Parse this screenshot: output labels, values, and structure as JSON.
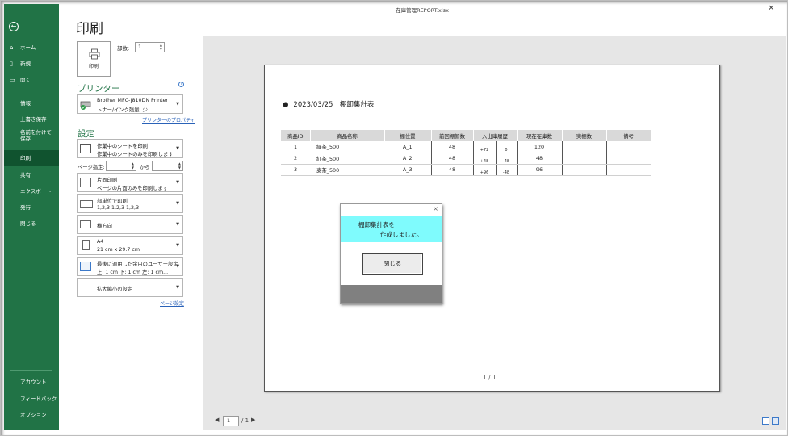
{
  "window": {
    "title": "在庫管理REPORT.xlsx",
    "close": "✕"
  },
  "sidebar": {
    "back": "←",
    "items": [
      {
        "label": "ホーム",
        "icon": "⌂"
      },
      {
        "label": "新規",
        "icon": "▯"
      },
      {
        "label": "開く",
        "icon": "▭"
      },
      {
        "label": "情報"
      },
      {
        "label": "上書き保存"
      },
      {
        "label": "名前を付けて保存"
      },
      {
        "label": "印刷"
      },
      {
        "label": "共有"
      },
      {
        "label": "エクスポート"
      },
      {
        "label": "発行"
      },
      {
        "label": "閉じる"
      }
    ],
    "bottom": [
      {
        "label": "アカウント"
      },
      {
        "label": "フィードバック"
      },
      {
        "label": "オプション"
      }
    ]
  },
  "page_title": "印刷",
  "print": {
    "button_label": "印刷",
    "copies_label": "部数:",
    "copies_value": "1"
  },
  "printer": {
    "heading": "プリンター",
    "name": "Brother MFC-J810DN Printer",
    "status": "トナー/インク残量: 少",
    "properties_link": "プリンターのプロパティ"
  },
  "settings": {
    "heading": "設定",
    "what": {
      "l1": "作業中のシートを印刷",
      "l2": "作業中のシートのみを印刷します"
    },
    "pages_label": "ページ指定:",
    "pages_to": "から",
    "sides": {
      "l1": "片面印刷",
      "l2": "ページの片面のみを印刷します"
    },
    "collate": {
      "l1": "部単位で印刷",
      "l2": "1,2,3    1,2,3    1,2,3"
    },
    "orientation": {
      "l1": "横方向"
    },
    "paper": {
      "l1": "A4",
      "l2": "21 cm x 29.7 cm"
    },
    "margins": {
      "l1": "最後に適用した余白のユーザー設定",
      "l2": "上: 1 cm 下: 1 cm 左: 1 cm..."
    },
    "scaling": {
      "l1": "拡大縮小の設定"
    },
    "page_setup_link": "ページ設定"
  },
  "sheet": {
    "title_bullet": "●",
    "title": "2023/03/25　棚卸集計表",
    "headers": [
      "商品ID",
      "商品名称",
      "棚位置",
      "前回棚卸数",
      "入出庫履歴",
      "現在在庫数",
      "実棚数",
      "備考"
    ],
    "rows": [
      {
        "id": "1",
        "name": "緑茶_500",
        "loc": "A_1",
        "prev": "48",
        "in": "+72",
        "out": "0",
        "cur": "120"
      },
      {
        "id": "2",
        "name": "紅茶_500",
        "loc": "A_2",
        "prev": "48",
        "in": "+48",
        "out": "-48",
        "cur": "48"
      },
      {
        "id": "3",
        "name": "麦茶_500",
        "loc": "A_3",
        "prev": "48",
        "in": "+96",
        "out": "-48",
        "cur": "96"
      }
    ],
    "page_indicator": "1 / 1"
  },
  "dialog": {
    "close": "×",
    "msg1": "棚卸集計表を",
    "msg2": "作成しました。",
    "button": "閉じる"
  },
  "pager": {
    "prev": "◀",
    "page": "1",
    "of": "/ 1",
    "next": "▶"
  },
  "colors": {
    "excel_green": "#217346",
    "selected": "#10532f",
    "dialog_msg_bg": "#7ffbfd"
  }
}
